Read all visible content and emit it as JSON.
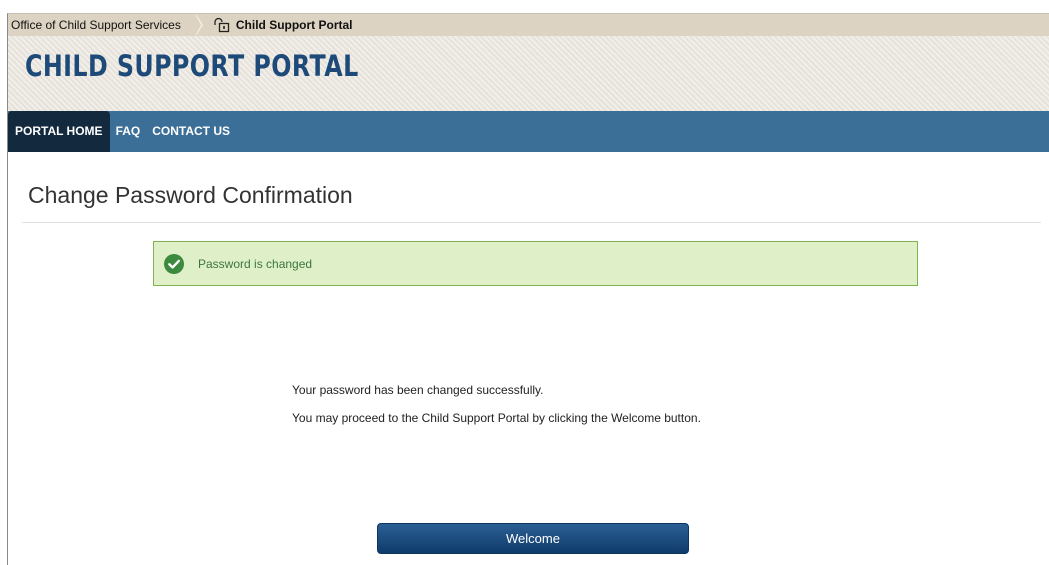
{
  "breadcrumb": {
    "parent": "Office of Child Support Services",
    "current": "Child Support Portal"
  },
  "banner": {
    "title": "CHILD SUPPORT PORTAL"
  },
  "nav": {
    "items": [
      {
        "label": "PORTAL HOME",
        "active": true
      },
      {
        "label": "FAQ",
        "active": false
      },
      {
        "label": "CONTACT US",
        "active": false
      }
    ]
  },
  "page": {
    "title": "Change Password Confirmation",
    "alert": "Password is changed",
    "message_line1": "Your password has been changed successfully.",
    "message_line2": "You may proceed to the Child Support Portal by clicking the Welcome button.",
    "button_label": "Welcome"
  },
  "colors": {
    "banner_title": "#1d4a78",
    "navbar": "#3b6f98",
    "nav_active": "#132a3e",
    "alert_bg": "#dff0c8",
    "alert_border": "#7fb252",
    "alert_text": "#3c763d",
    "check": "#3c8a3e",
    "button": "#1a4a7c"
  },
  "icons": {
    "breadcrumb_icon": "lock-icon",
    "alert_icon": "check-circle-icon"
  }
}
